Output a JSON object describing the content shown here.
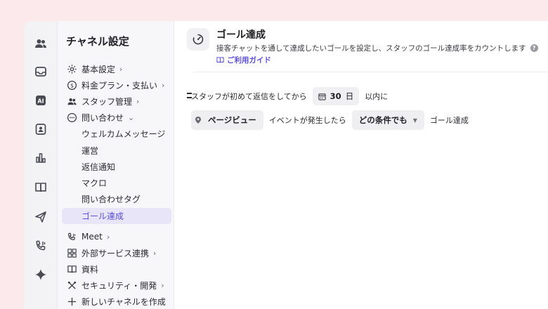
{
  "rail": {
    "icons": [
      "users-icon",
      "inbox-icon",
      "ai-icon",
      "contact-icon",
      "chart-icon",
      "book-icon",
      "send-icon",
      "phone-icon",
      "sparkle-icon"
    ],
    "ai_label": "AI"
  },
  "sidebar": {
    "title": "チャネル設定",
    "items": [
      {
        "label": "基本設定",
        "icon": "gear-icon",
        "chevron": "›"
      },
      {
        "label": "料金プラン・支払い",
        "icon": "dollar-icon",
        "chevron": "›"
      },
      {
        "label": "スタッフ管理",
        "icon": "users-icon",
        "chevron": "›"
      },
      {
        "label": "問い合わせ",
        "icon": "chat-icon",
        "chevron": "⌄"
      }
    ],
    "sub_items": [
      "ウェルカムメッセージ",
      "運営",
      "返信通知",
      "マクロ",
      "問い合わせタグ",
      "ゴール達成"
    ],
    "lower_items": [
      {
        "label": "Meet",
        "icon": "phone-icon",
        "chevron": "›"
      },
      {
        "label": "外部サービス連携",
        "icon": "grid-icon",
        "chevron": "›"
      },
      {
        "label": "資料",
        "icon": "book-icon",
        "chevron": ""
      },
      {
        "label": "セキュリティ・開発",
        "icon": "tools-icon",
        "chevron": "›"
      },
      {
        "label": "新しいチャネルを作成",
        "icon": "plus-icon",
        "chevron": ""
      }
    ]
  },
  "header": {
    "title": "ゴール達成",
    "description": "接客チャットを通して達成したいゴールを設定し、スタッフのゴール達成率をカウントします",
    "help": "?",
    "guide_label": "ご利用ガイド"
  },
  "rule": {
    "prefix": "スタッフが初めて返信をしてから",
    "days_value": "30",
    "days_unit": "日",
    "suffix": "以内に",
    "event_label": "ページビュー",
    "event_text": "イベントが発生したら",
    "condition_label": "どの条件でも",
    "result_text": "ゴール達成"
  },
  "colors": {
    "accent": "#5b4fd6",
    "background": "#fbe9ec"
  }
}
